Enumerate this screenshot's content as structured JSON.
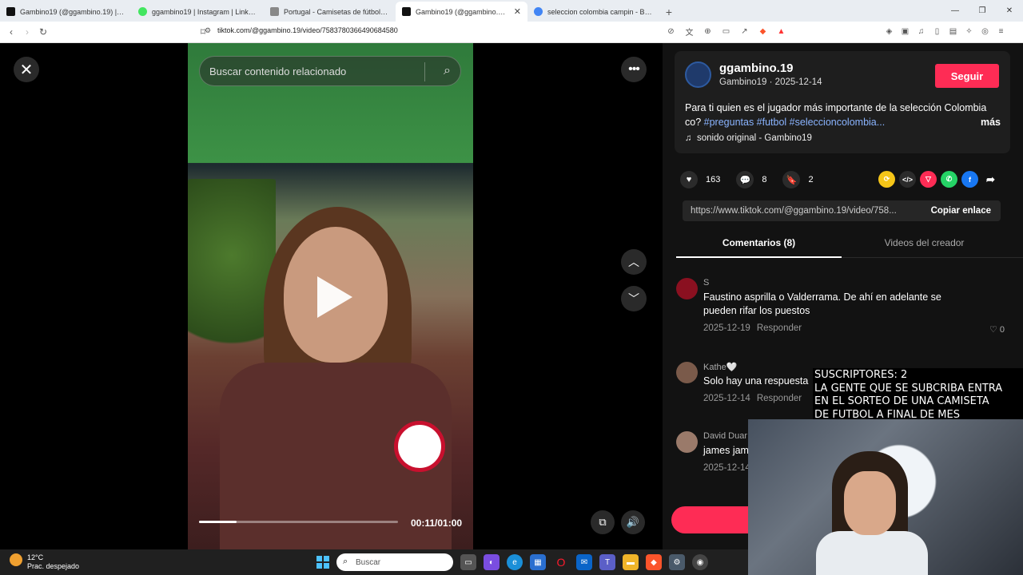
{
  "browser": {
    "tabs": [
      {
        "title": "Gambino19 (@ggambino.19) | TikTok",
        "color": "#111111"
      },
      {
        "title": "ggambino19 | Instagram | Linktree",
        "color": "#43e660"
      },
      {
        "title": "Portugal - Camisetas de fútbol barat",
        "color": "#888888"
      },
      {
        "title": "Gambino19 (@ggambino.19) | Ti",
        "color": "#111111",
        "active": true
      },
      {
        "title": "seleccion colombia campin - Buscar",
        "color": "#4285f4"
      }
    ],
    "url": "tiktok.com/@ggambino.19/video/7583780366490684580"
  },
  "video": {
    "search_placeholder": "Buscar contenido relacionado",
    "time": "00:11/01:00",
    "progress": 0.19
  },
  "post": {
    "username": "ggambino.19",
    "subline": "Gambino19 · 2025-12-14",
    "follow_label": "Seguir",
    "caption_text": "Para ti quien es el jugador más importante de la selección Colombia co? ",
    "tags": "#preguntas #futbol #seleccioncolombia...",
    "more_label": "más",
    "sound": "sonido original - Gambino19",
    "likes": "163",
    "comments_count": "8",
    "saves": "2",
    "link": "https://www.tiktok.com/@ggambino.19/video/758...",
    "copy_label": "Copiar enlace"
  },
  "tabs": {
    "comments": "Comentarios (8)",
    "creator": "Videos del creador"
  },
  "comments": [
    {
      "user": "S",
      "text": "Faustino asprilla o Valderrama. De ahí en adelante se pueden rifar los puestos",
      "date": "2025-12-19",
      "reply": "Responder",
      "likes": "0",
      "avatar": "#8a1020"
    },
    {
      "user": "Kathe🤍",
      "text": "Solo hay una respuesta",
      "date": "2025-12-14",
      "reply": "Responder",
      "likes": "",
      "avatar": "#7a5a4a"
    },
    {
      "user": "David Duar",
      "text": "james jam",
      "date": "2025-12-14",
      "reply": "",
      "likes": "",
      "avatar": "#9a7a6a"
    }
  ],
  "overlay": {
    "text": "SUSCRIPTORES: 2\nLA GENTE QUE SE SUBCRIBA  ENTRA\n EN EL SORTEO DE UNA CAMISETA\nDE FUTBOL A FINAL DE MES"
  },
  "taskbar": {
    "temp": "12°C",
    "weather": "Prac. despejado",
    "search": "Buscar"
  }
}
